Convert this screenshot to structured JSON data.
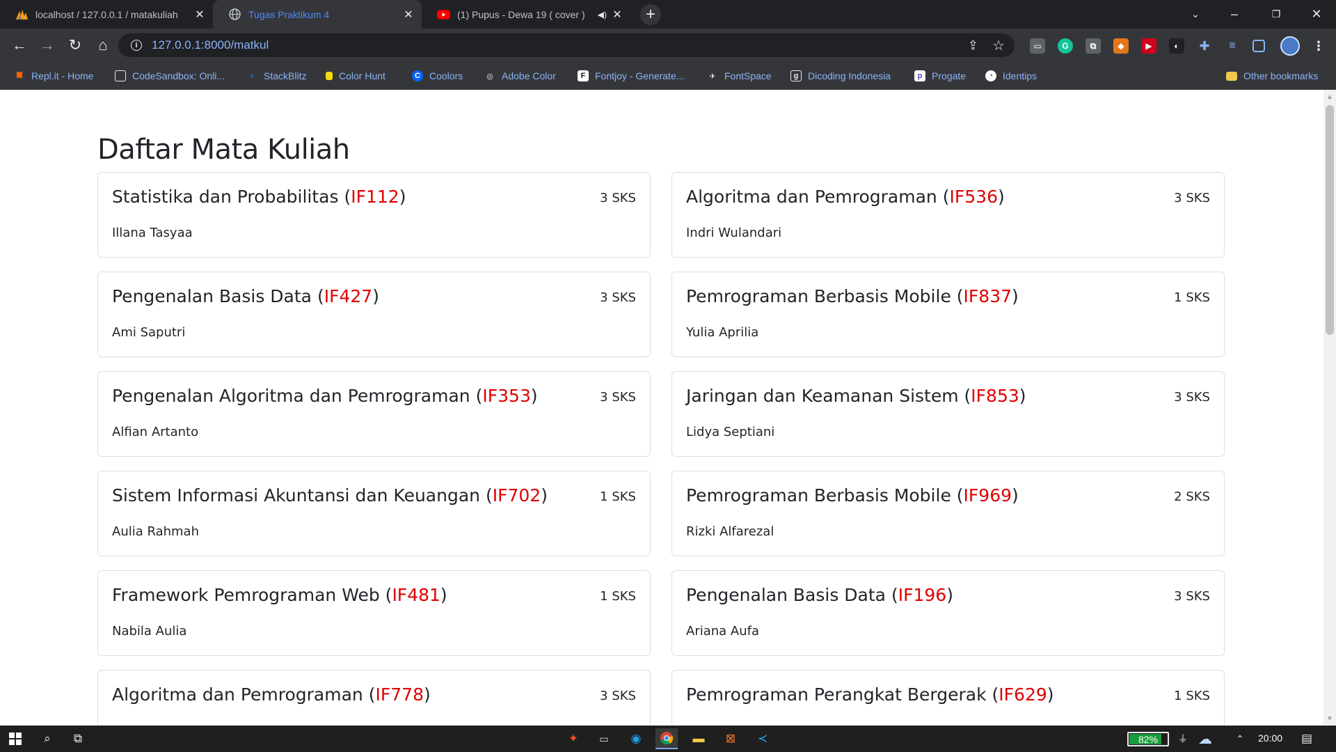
{
  "browser": {
    "tabs": [
      {
        "title": "localhost / 127.0.0.1 / matakuliah",
        "icon": "phpmyadmin-icon",
        "active": false
      },
      {
        "title": "Tugas Praktikum 4",
        "icon": "globe-icon",
        "active": true
      },
      {
        "title": "(1) Pupus - Dewa 19 ( cover )",
        "icon": "youtube-icon",
        "active": false
      }
    ],
    "new_tab_label": "+",
    "url": "127.0.0.1:8000/matkul",
    "bookmarks": [
      {
        "label": "Repl.it - Home",
        "color": "#f26207"
      },
      {
        "label": "CodeSandbox: Onli...",
        "color": "#151515"
      },
      {
        "label": "StackBlitz",
        "color": "#1389fd"
      },
      {
        "label": "Color Hunt",
        "color": "#f5d90a"
      },
      {
        "label": "Coolors",
        "color": "#0066ff"
      },
      {
        "label": "Adobe Color",
        "color": "#1c1c1c"
      },
      {
        "label": "Fontjoy - Generate...",
        "color": "#1a1a1a"
      },
      {
        "label": "FontSpace",
        "color": "#222222"
      },
      {
        "label": "Dicoding Indonesia",
        "color": "#2d3e50"
      },
      {
        "label": "Progate",
        "color": "#ffffff"
      },
      {
        "label": "Identips",
        "color": "#ffffff"
      }
    ],
    "other_bookmarks": "Other bookmarks"
  },
  "page": {
    "title": "Daftar Mata Kuliah",
    "courses": [
      {
        "name": "Statistika dan Probabilitas",
        "code": "IF112",
        "sks": "3 SKS",
        "lecturer": "Illana Tasyaa"
      },
      {
        "name": "Algoritma dan Pemrograman",
        "code": "IF536",
        "sks": "3 SKS",
        "lecturer": "Indri Wulandari"
      },
      {
        "name": "Pengenalan Basis Data",
        "code": "IF427",
        "sks": "3 SKS",
        "lecturer": "Ami Saputri"
      },
      {
        "name": "Pemrograman Berbasis Mobile",
        "code": "IF837",
        "sks": "1 SKS",
        "lecturer": "Yulia Aprilia"
      },
      {
        "name": "Pengenalan Algoritma dan Pemrograman",
        "code": "IF353",
        "sks": "3 SKS",
        "lecturer": "Alfian Artanto"
      },
      {
        "name": "Jaringan dan Keamanan Sistem",
        "code": "IF853",
        "sks": "3 SKS",
        "lecturer": "Lidya Septiani"
      },
      {
        "name": "Sistem Informasi Akuntansi dan Keuangan",
        "code": "IF702",
        "sks": "1 SKS",
        "lecturer": "Aulia Rahmah"
      },
      {
        "name": "Pemrograman Berbasis Mobile",
        "code": "IF969",
        "sks": "2 SKS",
        "lecturer": "Rizki Alfarezal"
      },
      {
        "name": "Framework Pemrograman Web",
        "code": "IF481",
        "sks": "1 SKS",
        "lecturer": "Nabila Aulia"
      },
      {
        "name": "Pengenalan Basis Data",
        "code": "IF196",
        "sks": "3 SKS",
        "lecturer": "Ariana Aufa"
      },
      {
        "name": "Algoritma dan Pemrograman",
        "code": "IF778",
        "sks": "3 SKS",
        "lecturer": ""
      },
      {
        "name": "Pemrograman Perangkat Bergerak",
        "code": "IF629",
        "sks": "1 SKS",
        "lecturer": ""
      }
    ],
    "paren_open": "(",
    "paren_close": ")"
  },
  "taskbar": {
    "battery_percent": "82%",
    "battery_level": 0.82,
    "clock": "20:00",
    "accent": "#1a9c3c"
  }
}
